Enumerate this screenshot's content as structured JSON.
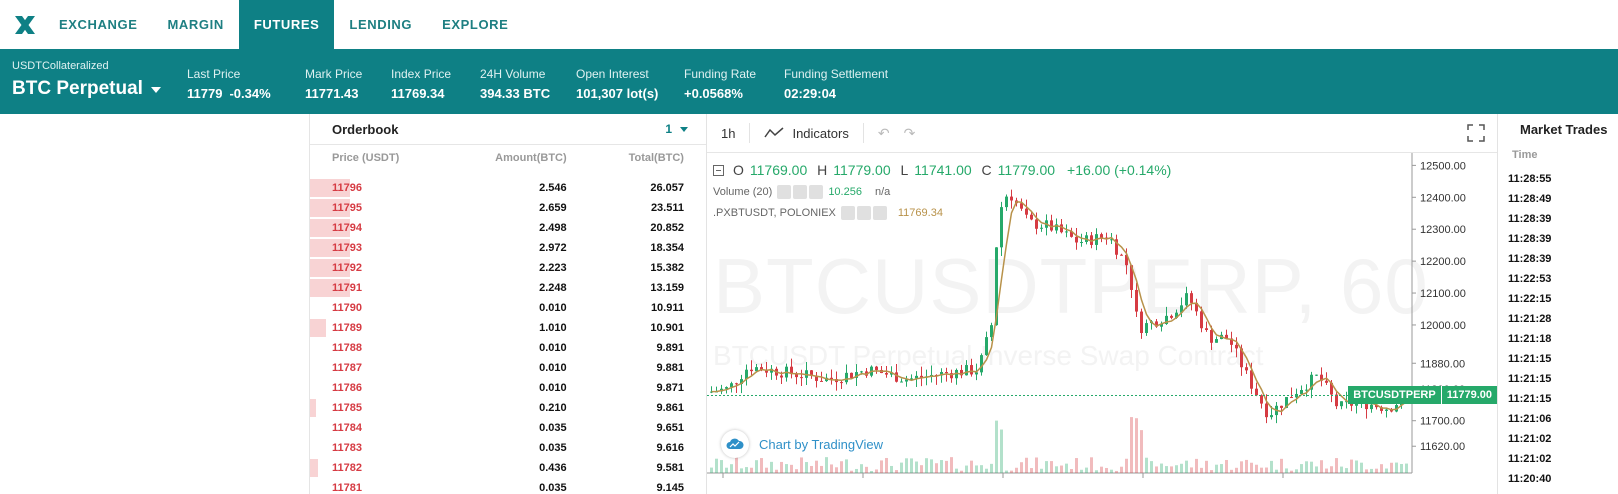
{
  "nav": {
    "logo_icon": "x-logo-icon",
    "items": [
      {
        "label": "EXCHANGE"
      },
      {
        "label": "MARGIN"
      },
      {
        "label": "FUTURES",
        "active": true
      },
      {
        "label": "LENDING"
      },
      {
        "label": "EXPLORE"
      }
    ]
  },
  "ticker": {
    "collateral": "USDTCollateralized",
    "market": "BTC Perpetual",
    "stats": [
      {
        "label": "Last Price",
        "value": "11779",
        "change": "-0.34%"
      },
      {
        "label": "Mark Price",
        "value": "11771.43"
      },
      {
        "label": "Index Price",
        "value": "11769.34"
      },
      {
        "label": "24H Volume",
        "value": "394.33 BTC"
      },
      {
        "label": "Open Interest",
        "value": "101,307 lot(s)"
      },
      {
        "label": "Funding Rate",
        "value": "+0.0568%"
      },
      {
        "label": "Funding Settlement",
        "value": "02:29:04"
      }
    ]
  },
  "orderbook": {
    "title": "Orderbook",
    "precision": "1",
    "columns": [
      "Price (USDT)",
      "Amount(BTC)",
      "Total(BTC)"
    ],
    "rows": [
      {
        "price": "11796",
        "amount": "2.546",
        "total": "26.057",
        "depth": 0.1
      },
      {
        "price": "11795",
        "amount": "2.659",
        "total": "23.511",
        "depth": 0.1
      },
      {
        "price": "11794",
        "amount": "2.498",
        "total": "20.852",
        "depth": 0.1
      },
      {
        "price": "11793",
        "amount": "2.972",
        "total": "18.354",
        "depth": 0.1
      },
      {
        "price": "11792",
        "amount": "2.223",
        "total": "15.382",
        "depth": 0.1
      },
      {
        "price": "11791",
        "amount": "2.248",
        "total": "13.159",
        "depth": 0.1
      },
      {
        "price": "11790",
        "amount": "0.010",
        "total": "10.911",
        "depth": 0.0
      },
      {
        "price": "11789",
        "amount": "1.010",
        "total": "10.901",
        "depth": 0.04
      },
      {
        "price": "11788",
        "amount": "0.010",
        "total": "9.891",
        "depth": 0.0
      },
      {
        "price": "11787",
        "amount": "0.010",
        "total": "9.881",
        "depth": 0.0
      },
      {
        "price": "11786",
        "amount": "0.010",
        "total": "9.871",
        "depth": 0.0
      },
      {
        "price": "11785",
        "amount": "0.210",
        "total": "9.861",
        "depth": 0.01
      },
      {
        "price": "11784",
        "amount": "0.035",
        "total": "9.651",
        "depth": 0.0
      },
      {
        "price": "11783",
        "amount": "0.035",
        "total": "9.616",
        "depth": 0.0
      },
      {
        "price": "11782",
        "amount": "0.436",
        "total": "9.581",
        "depth": 0.02
      },
      {
        "price": "11781",
        "amount": "0.035",
        "total": "9.145",
        "depth": 0.0
      }
    ]
  },
  "chart": {
    "interval": "1h",
    "indicators_label": "Indicators",
    "ohlc": {
      "o": "11769.00",
      "h": "11779.00",
      "l": "11741.00",
      "c": "11779.00",
      "change": "+16.00 (+0.14%)"
    },
    "volume_label": "Volume (20)",
    "volume_value": "10.256",
    "volume_na": "n/a",
    "index_label": ".PXBTUSDT, POLONIEX",
    "index_value": "11769.34",
    "watermark_symbol": "BTCUSDTPERP, 60",
    "watermark_desc": "BTCUSDT Perpetual Inverse Swap Contract",
    "price_tag_symbol": "BTCUSDTPERP",
    "price_tag_value": "11779.00",
    "tv_label": "Chart by TradingView",
    "colors": {
      "up": "#26a96a",
      "down": "#d63b43",
      "ma": "#b8924a"
    }
  },
  "chart_data": {
    "type": "candlestick",
    "y_ticks": [
      "12500.00",
      "12400.00",
      "12300.00",
      "12200.00",
      "12100.00",
      "12000.00",
      "11880.00",
      "11800.00",
      "11700.00",
      "11620.00"
    ],
    "ylim": [
      11580,
      12520
    ]
  },
  "trades": {
    "title": "Market Trades",
    "time_col": "Time",
    "times": [
      "11:28:55",
      "11:28:49",
      "11:28:39",
      "11:28:39",
      "11:28:39",
      "11:22:53",
      "11:22:15",
      "11:21:28",
      "11:21:18",
      "11:21:15",
      "11:21:15",
      "11:21:15",
      "11:21:06",
      "11:21:02",
      "11:21:02",
      "11:20:40"
    ]
  }
}
